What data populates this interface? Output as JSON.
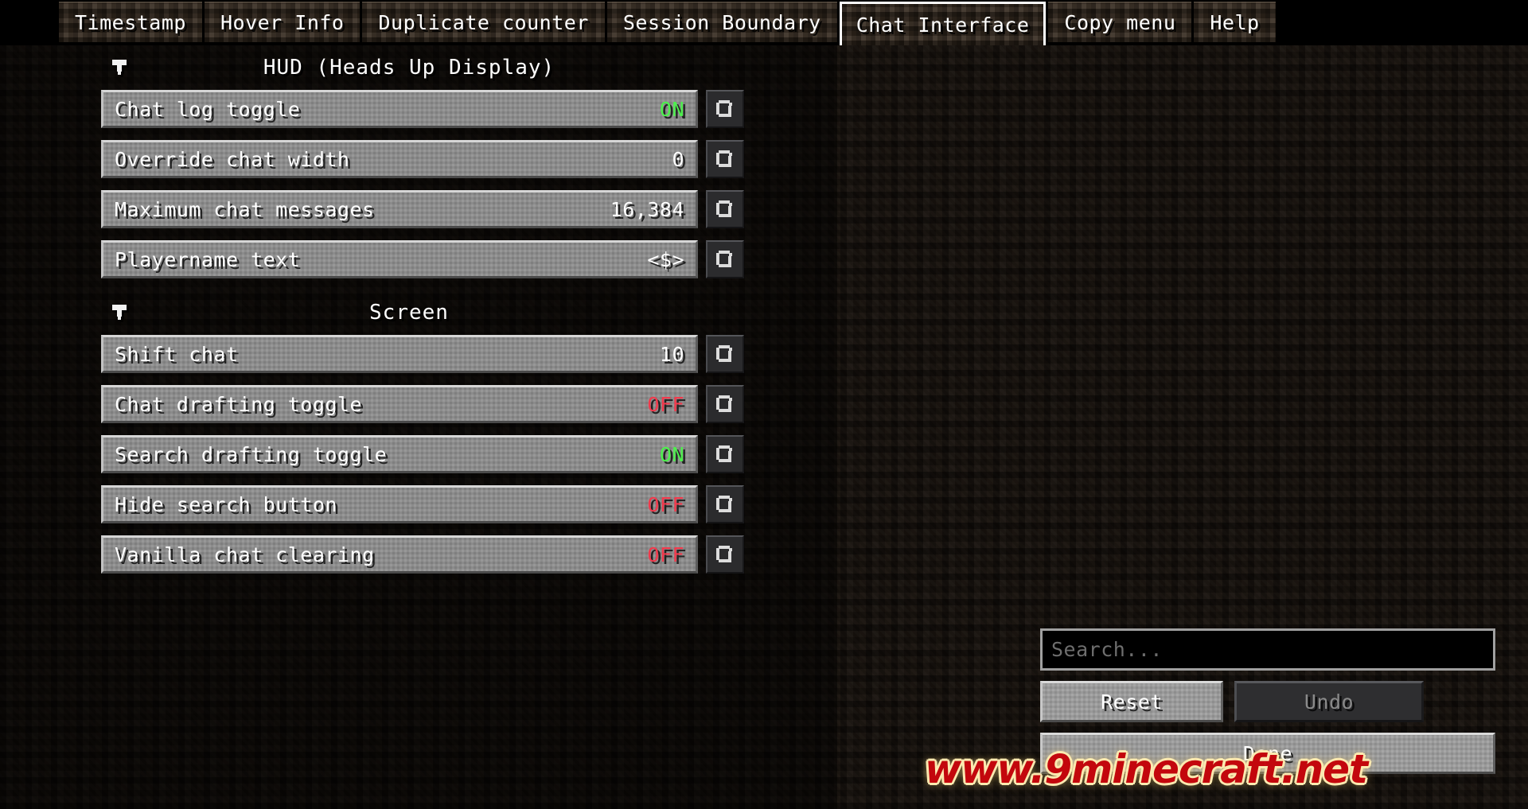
{
  "window": {
    "title": "Chat Interface",
    "watermark": "www.9minecraft.net"
  },
  "tabs": [
    {
      "label": "Timestamp",
      "selected": false
    },
    {
      "label": "Hover Info",
      "selected": false
    },
    {
      "label": "Duplicate counter",
      "selected": false
    },
    {
      "label": "Session Boundary",
      "selected": false
    },
    {
      "label": "Chat Interface",
      "selected": true
    },
    {
      "label": "Copy menu",
      "selected": false
    },
    {
      "label": "Help",
      "selected": false
    }
  ],
  "sections": [
    {
      "title": "HUD (Heads Up Display)",
      "expanded": true,
      "arrow_icon": "triangle-down-icon",
      "options": [
        {
          "label": "Chat log toggle",
          "value": "ON",
          "value_kind": "on",
          "reset_icon": "reset-arrow-icon"
        },
        {
          "label": "Override chat width",
          "value": "0",
          "value_kind": "num",
          "reset_icon": "reset-arrow-icon"
        },
        {
          "label": "Maximum chat messages",
          "value": "16,384",
          "value_kind": "num",
          "reset_icon": "reset-arrow-icon"
        },
        {
          "label": "Playername text",
          "value": "<$>",
          "value_kind": "num",
          "reset_icon": "reset-arrow-icon"
        }
      ]
    },
    {
      "title": "Screen",
      "expanded": true,
      "arrow_icon": "triangle-down-icon",
      "options": [
        {
          "label": "Shift chat",
          "value": "10",
          "value_kind": "num",
          "reset_icon": "reset-arrow-icon"
        },
        {
          "label": "Chat drafting toggle",
          "value": "OFF",
          "value_kind": "off",
          "reset_icon": "reset-arrow-icon"
        },
        {
          "label": "Search drafting toggle",
          "value": "ON",
          "value_kind": "on",
          "reset_icon": "reset-arrow-icon"
        },
        {
          "label": "Hide search button",
          "value": "OFF",
          "value_kind": "off",
          "reset_icon": "reset-arrow-icon"
        },
        {
          "label": "Vanilla chat clearing",
          "value": "OFF",
          "value_kind": "off",
          "reset_icon": "reset-arrow-icon"
        }
      ]
    }
  ],
  "controls": {
    "search": {
      "value": "",
      "placeholder": "Search..."
    },
    "reset_label": "Reset",
    "reset_enabled": true,
    "undo_label": "Undo",
    "undo_enabled": false,
    "done_label": "Done",
    "done_enabled": true
  },
  "colors": {
    "value_on": "#4cf24c",
    "value_off": "#f2394c",
    "value_default": "#ffffff",
    "widget_bg": "#8b8b8b",
    "panel_bg": "#2b2119",
    "selected_tab_border": "#ffffff",
    "watermark": "#c3070d"
  }
}
